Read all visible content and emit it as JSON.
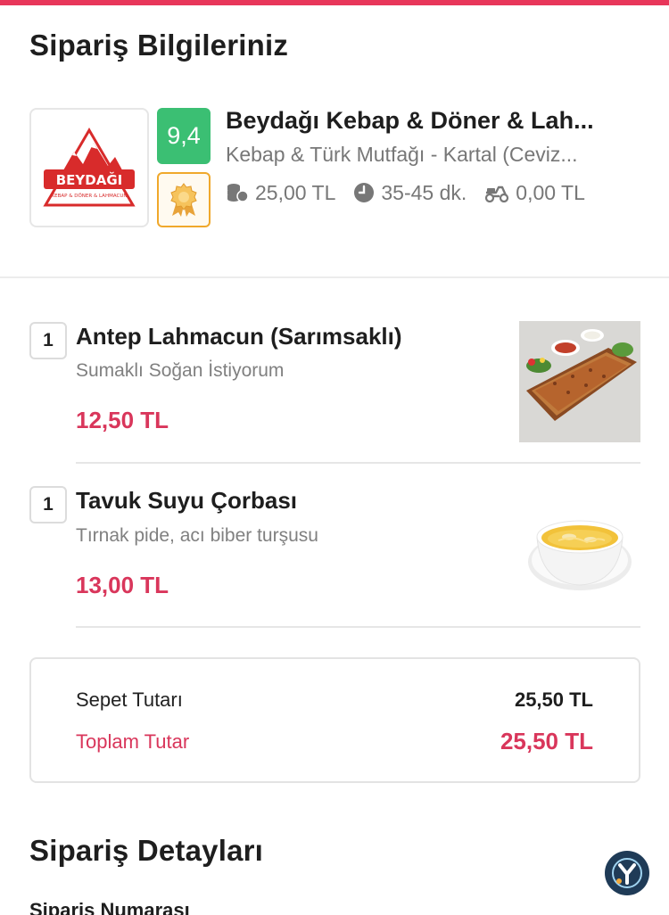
{
  "colors": {
    "brand": "#e8365a",
    "price": "#d9365b",
    "rating_bg": "#3bbf73",
    "badge_border": "#f0a82b"
  },
  "order_info": {
    "title": "Sipariş Bilgileriniz"
  },
  "restaurant": {
    "logo_text": "BEYDAĞI",
    "logo_subtext": "KEBAP & DÖNER & LAHMACUN",
    "rating": "9,4",
    "badge_icon": "award-badge-icon",
    "name": "Beydağı Kebap & Döner & Lah...",
    "category": "Kebap & Türk Mutfağı - Kartal (Ceviz...",
    "min_order": "25,00 TL",
    "delivery_time": "35-45 dk.",
    "delivery_fee": "0,00 TL"
  },
  "items": [
    {
      "qty": "1",
      "name": "Antep Lahmacun (Sarımsaklı)",
      "note": "Sumaklı Soğan İstiyorum",
      "price": "12,50 TL",
      "image_icon": "lahmacun-image"
    },
    {
      "qty": "1",
      "name": "Tavuk Suyu Çorbası",
      "note": "Tırnak pide, acı biber turşusu",
      "price": "13,00 TL",
      "image_icon": "soup-image"
    }
  ],
  "summary": {
    "basket_label": "Sepet Tutarı",
    "basket_value": "25,50 TL",
    "total_label": "Toplam Tutar",
    "total_value": "25,50 TL"
  },
  "order_details": {
    "title": "Sipariş Detayları",
    "order_number_label": "Sipariş Numarası"
  }
}
